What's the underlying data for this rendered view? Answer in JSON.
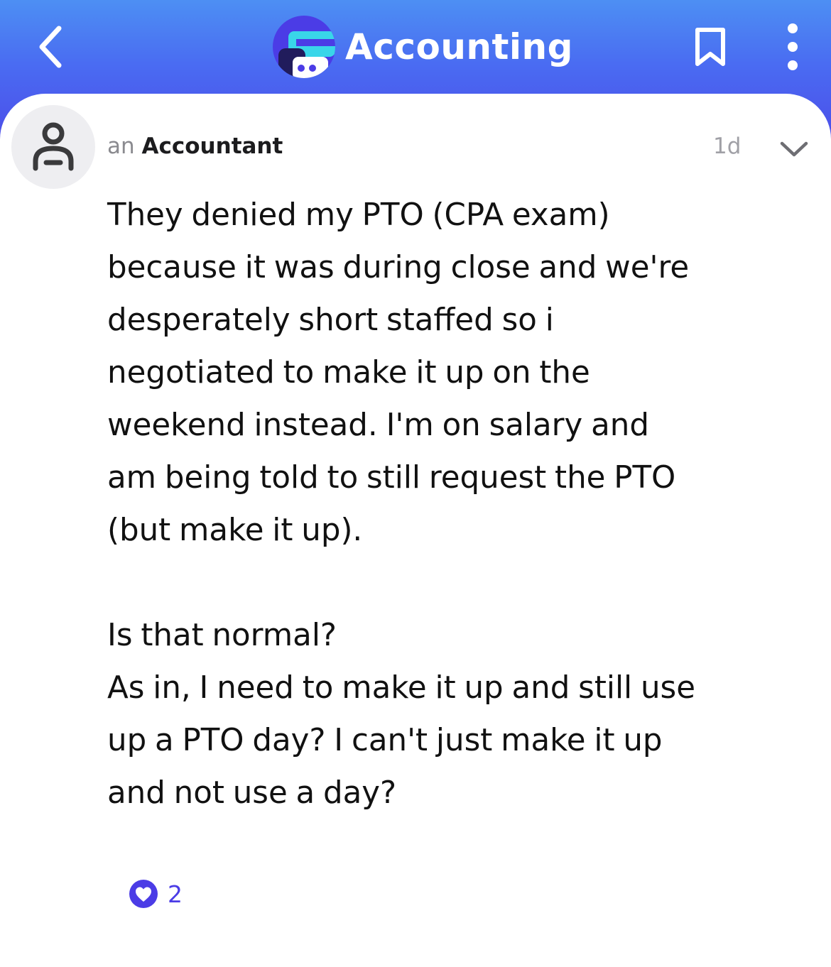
{
  "header": {
    "back_icon": "chevron-left-icon",
    "community_logo_icon": "accounting-community-logo",
    "title": "Accounting",
    "bookmark_icon": "bookmark-icon",
    "more_icon": "vertical-ellipsis-icon",
    "accent_color": "#4b3ce6",
    "gradient_top": "#4d8ff3",
    "gradient_bottom": "#4c4de9"
  },
  "post": {
    "avatar_icon": "anonymous-user-icon",
    "author_prefix": "an",
    "author_name": "Accountant",
    "time_ago": "1d",
    "expand_icon": "chevron-down-icon",
    "body": "They denied my PTO (CPA exam)\nbecause it was during close and we're\ndesperately short staffed so i\nnegotiated to make it up on the\nweekend instead. I'm on salary and\nam being told to still request the PTO\n(but make it up).\n\nIs that normal?\nAs in, I need to make it up and still use\nup a PTO day? I can't just make it up\nand not use a day?",
    "like_icon": "heart-icon",
    "like_count": "2"
  }
}
